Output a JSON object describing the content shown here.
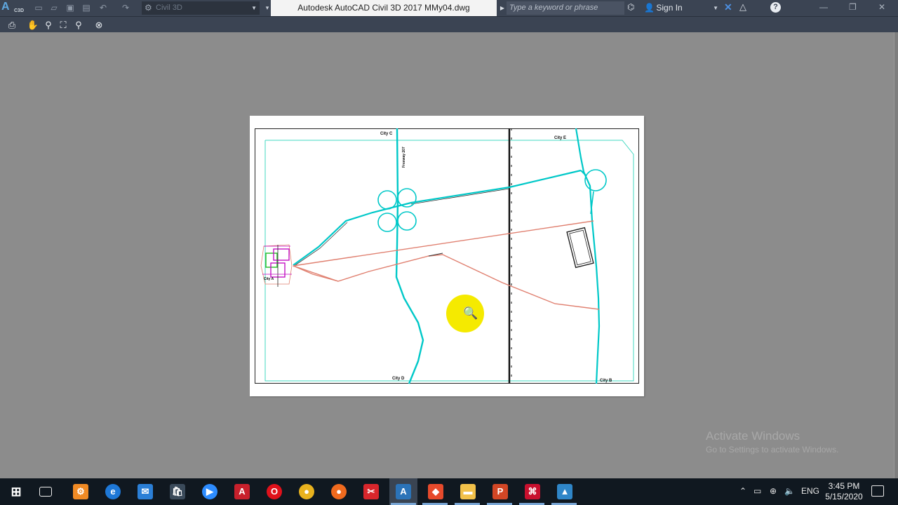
{
  "window": {
    "title": "Autodesk AutoCAD Civil 3D 2017    MMy04.dwg",
    "app_logo": "A",
    "app_logo_sub": "C3D",
    "workspace": "Civil 3D",
    "search_placeholder": "Type a keyword or phrase",
    "sign_in": "Sign In",
    "help": "?"
  },
  "quick_access": [
    "new-icon",
    "open-icon",
    "save-icon",
    "save-as-icon",
    "plot-icon",
    "undo-icon",
    "redo-icon"
  ],
  "preview_toolbar": [
    "print-icon",
    "pan-icon",
    "zoom-icon",
    "zoom-window-icon",
    "zoom-original-icon",
    "close-preview-icon"
  ],
  "drawing": {
    "labels": {
      "city_top_left": "City C",
      "city_top_right": "City E",
      "city_bottom_mid": "City D",
      "city_bottom_right": "City B",
      "city_left": "City A",
      "freeway": "Freeway 207"
    },
    "colors": {
      "road": "#00c8c8",
      "border_inner": "#40d8c0",
      "pipeline": "#e08070",
      "rail": "#000000",
      "subdivision_magenta": "#c000c0",
      "subdivision_green": "#30c030"
    }
  },
  "watermark": {
    "line1": "Activate Windows",
    "line2": "Go to Settings to activate Windows."
  },
  "taskbar": {
    "apps": [
      "start-icon",
      "task-view-icon",
      "tools-icon",
      "edge-icon",
      "mail-icon",
      "store-icon",
      "zoom-icon",
      "autocad-icon",
      "opera-icon",
      "chrome-icon",
      "firefox-icon",
      "snipping-icon",
      "civil3d-icon",
      "ms-project-icon",
      "file-explorer-icon",
      "powerpoint-icon",
      "acrobat-icon",
      "photos-icon"
    ],
    "tray_lang": "ENG",
    "time": "3:45 PM",
    "date": "5/15/2020"
  }
}
